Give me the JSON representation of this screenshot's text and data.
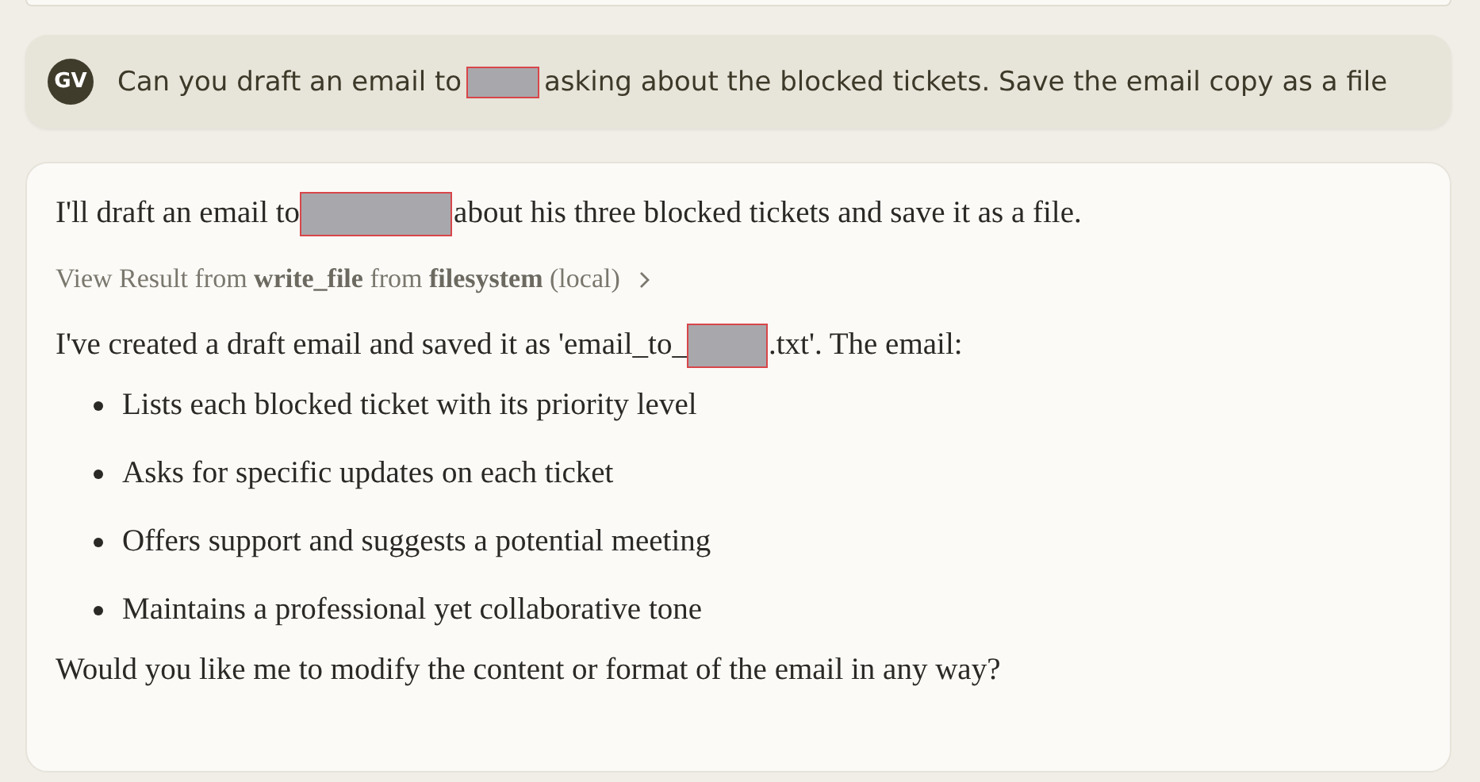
{
  "user_message": {
    "avatar": "GV",
    "parts": [
      {
        "kind": "text",
        "text": "Can you draft an email to"
      },
      {
        "kind": "redacted"
      },
      {
        "kind": "text",
        "text": "asking about the blocked tickets. Save the email copy as a file"
      }
    ]
  },
  "response": {
    "intro": [
      {
        "kind": "text",
        "text": "I'll draft an email to"
      },
      {
        "kind": "redacted"
      },
      {
        "kind": "text",
        "text": "about his three blocked tickets and save it as a file."
      }
    ],
    "tool_result": "View Result from **write_file** from **filesystem** (local)",
    "summary": [
      {
        "kind": "text",
        "text": "I've created a draft email and saved it as 'email_to_"
      },
      {
        "kind": "redacted"
      },
      {
        "kind": "text",
        "text": ".txt'. The email:"
      }
    ],
    "bullets": [
      "Lists each blocked ticket with its priority level",
      "Asks for specific updates on each ticket",
      "Offers support and suggests a potential meeting",
      "Maintains a professional yet collaborative tone"
    ],
    "closing": "Would you like me to modify the content or format of the email in any way?"
  }
}
